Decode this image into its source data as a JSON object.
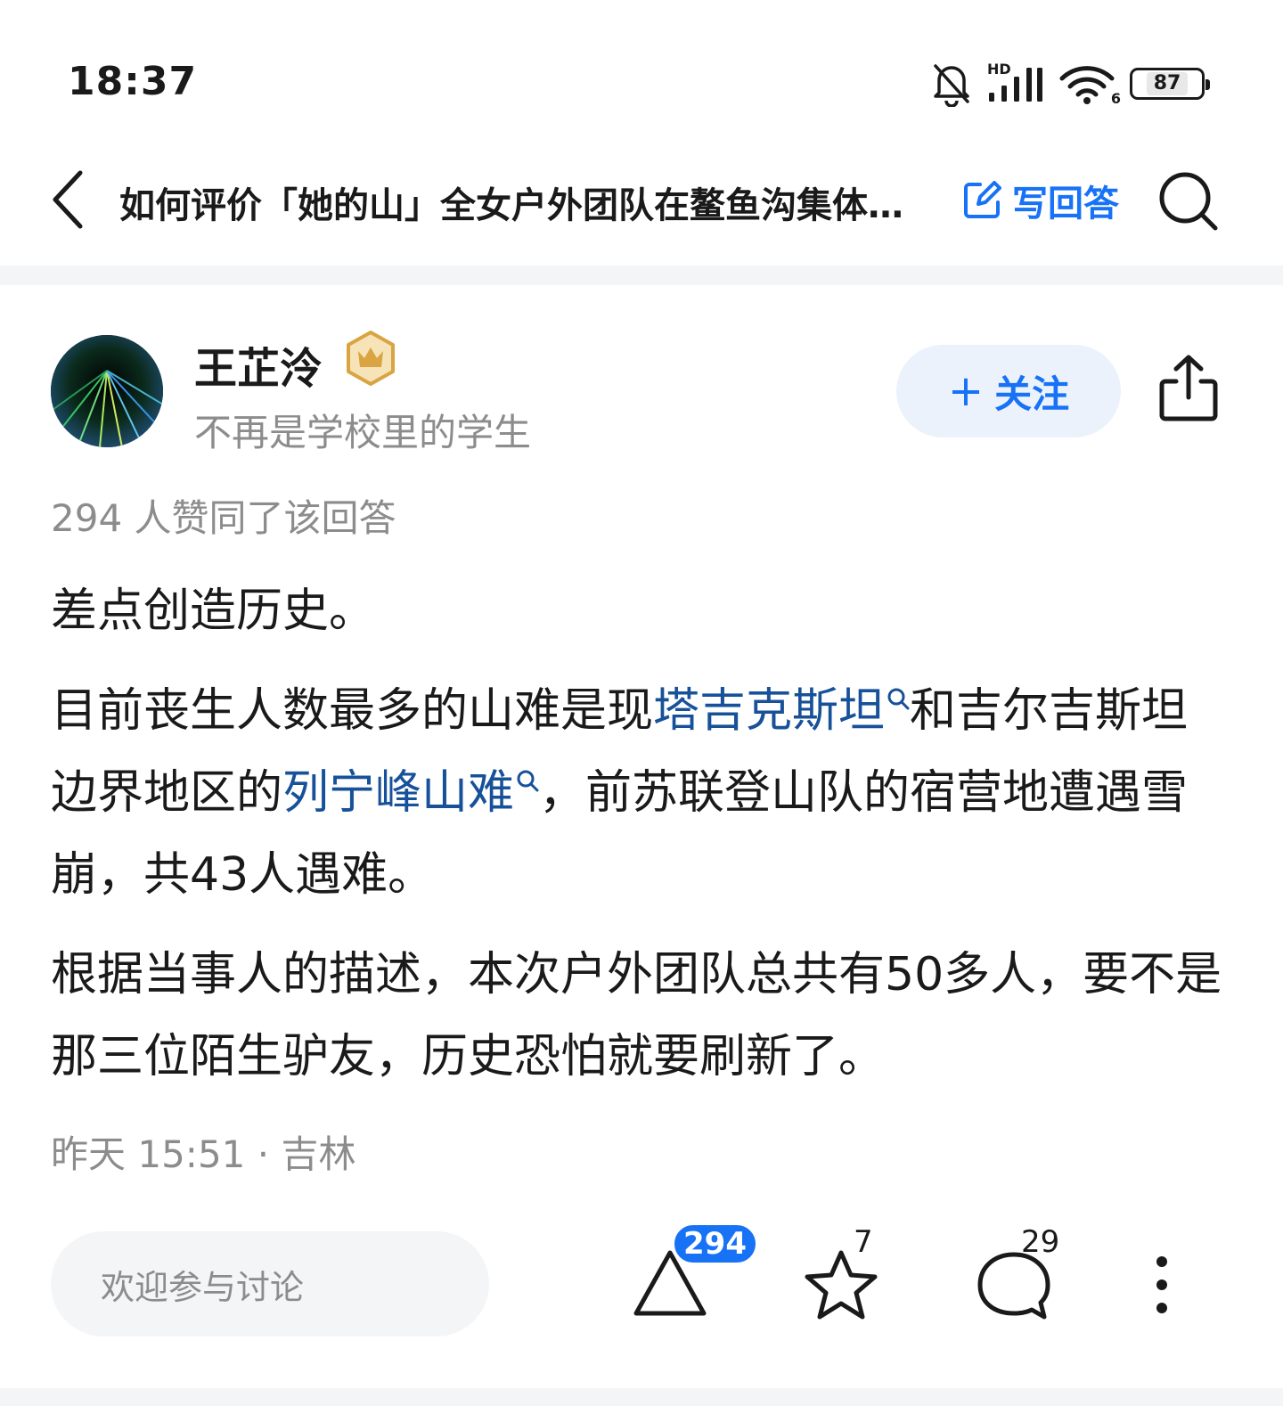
{
  "status_bar": {
    "time": "18:37",
    "network_label": "HD",
    "wifi_label": "6",
    "battery": "87",
    "icons": [
      "mute-bell-icon",
      "signal-icon",
      "wifi-icon",
      "battery-icon"
    ]
  },
  "nav": {
    "title": "如何评价「她的山」全女户外团队在鳌鱼沟集体遇险，称在三位陌生驴友帮助下脱险？",
    "write_answer": "写回答",
    "icons": [
      "back-icon",
      "edit-icon",
      "search-icon"
    ]
  },
  "author": {
    "name": "王芷泠",
    "bio": "不再是学校里的学生",
    "follow_label": "关注",
    "follow_prefix": "+",
    "badge": "crown-badge-icon"
  },
  "answer": {
    "vote_summary": "294 人赞同了该回答",
    "paragraphs": {
      "p1": "差点创造历史。",
      "p2_a": "目前丧生人数最多的山难是现",
      "p2_link1": "塔吉克斯坦",
      "p2_b": "和吉尔吉斯坦边界地区的",
      "p2_link2": "列宁峰山难",
      "p2_c": "，前苏联登山队的宿营地遭遇雪崩，共43人遇难。",
      "p3": "根据当事人的描述，本次户外团队总共有50多人，要不是那三位陌生驴友，历史恐怕就要刷新了。"
    },
    "meta": "昨天 15:51 · 吉林"
  },
  "bottom_bar": {
    "comment_placeholder": "欢迎参与讨论",
    "vote_count": "294",
    "favorite_count": "7",
    "comment_count": "29"
  },
  "colors": {
    "accent": "#1772f6",
    "link": "#175199",
    "secondary_text": "#8c8c8c",
    "gold_badge": "#d9a441"
  }
}
